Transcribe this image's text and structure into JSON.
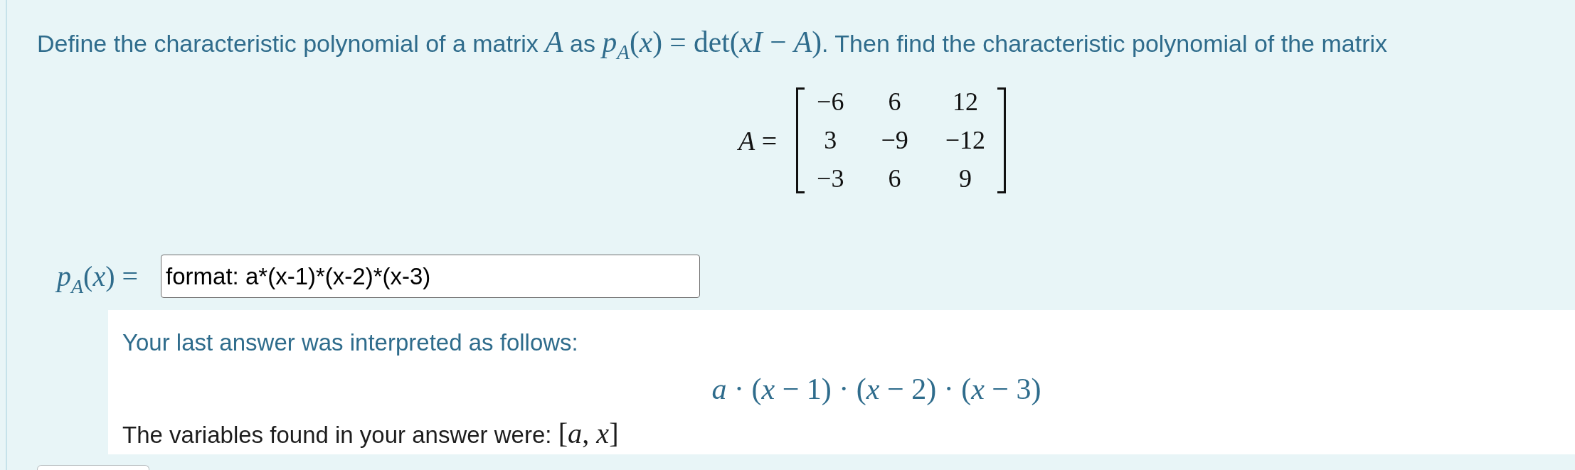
{
  "question": {
    "text": [
      {
        "kind": "text",
        "text": "Define the characteristic polynomial of a matrix "
      },
      {
        "kind": "math",
        "text": "*A*"
      },
      {
        "kind": "text",
        "text": " as "
      },
      {
        "kind": "math",
        "text": "*p*$_{A}$(*x*) = det(*xI* − *A*)"
      },
      {
        "kind": "text",
        "text": ". Then find the characteristic polynomial of the matrix"
      }
    ],
    "matrix": {
      "label": "*A* =",
      "rows": [
        [
          "−6",
          "6",
          "12"
        ],
        [
          "3",
          "−9",
          "−12"
        ],
        [
          "−3",
          "6",
          "9"
        ]
      ]
    }
  },
  "answer": {
    "label": "*p*$_{A}$(*x*) =",
    "value": "format: a*(x-1)*(x-2)*(x-3)"
  },
  "feedback": {
    "intro": "Your last answer was interpreted as follows:",
    "expression": "*a* · (*x* − 1) · (*x* − 2) · (*x* − 3)",
    "variables": [
      {
        "kind": "text",
        "text": "The variables found in your answer were: "
      },
      {
        "kind": "math",
        "text": "[*a*, *x*]"
      }
    ]
  }
}
